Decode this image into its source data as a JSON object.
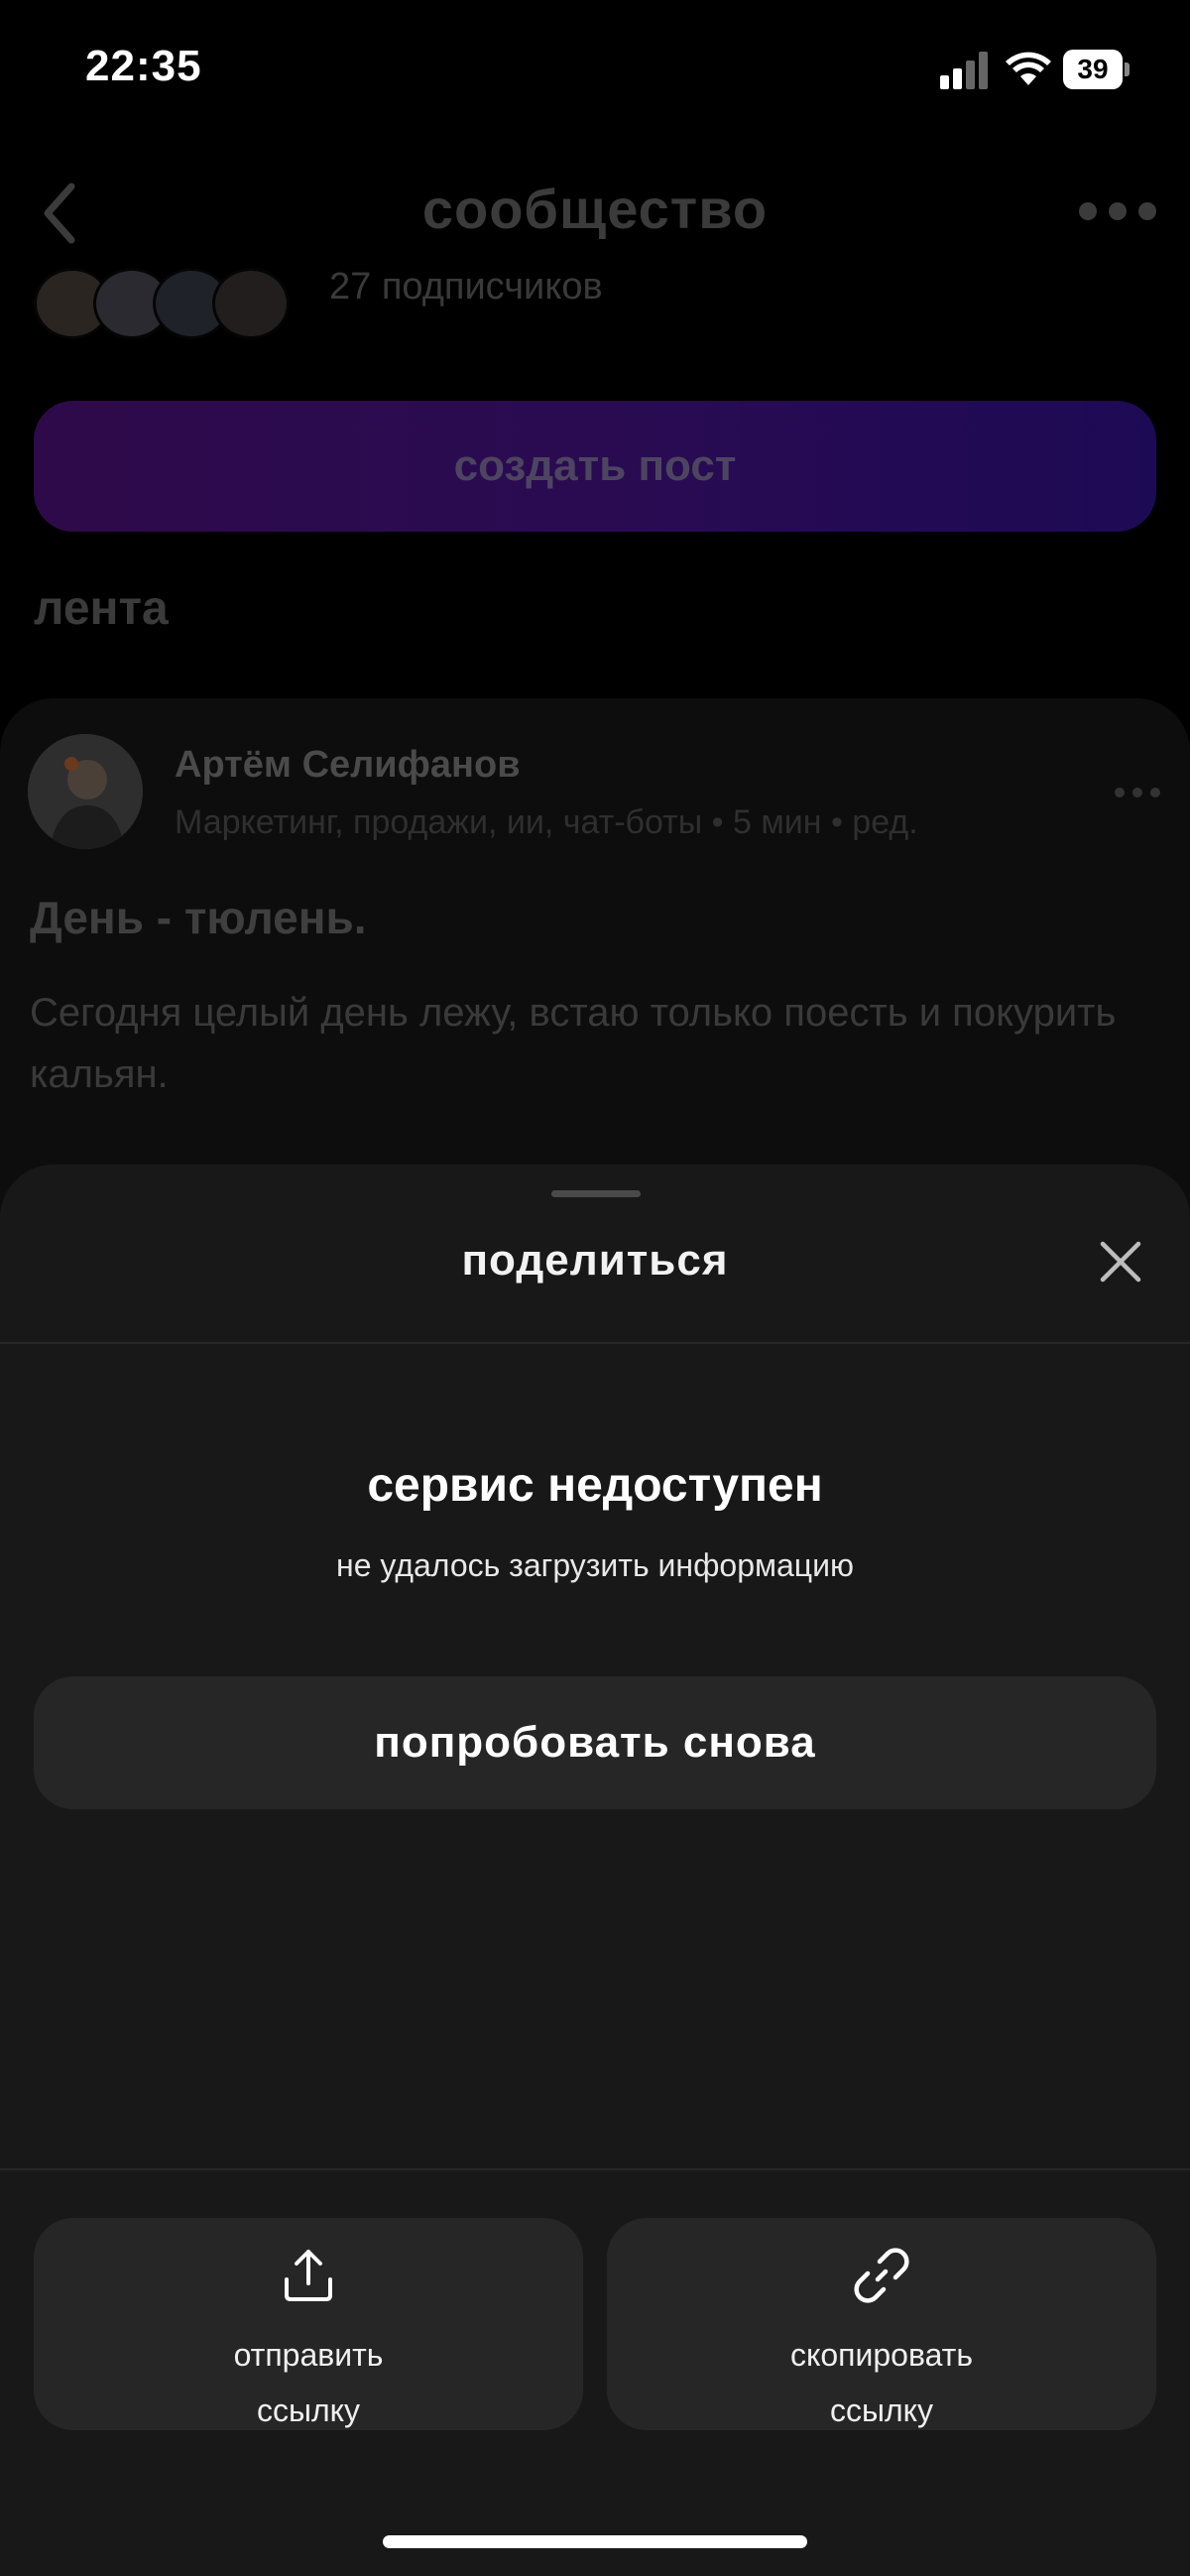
{
  "status_bar": {
    "time": "22:35",
    "battery": "39"
  },
  "header": {
    "title": "сообщество"
  },
  "community": {
    "subscribers": "27 подписчиков",
    "create_post_label": "создать пост",
    "feed_title": "лента"
  },
  "post": {
    "author": "Артём Селифанов",
    "meta": "Маркетинг, продажи, ии, чат-боты • 5 мин • ред.",
    "title": "День - тюлень.",
    "body": "Сегодня целый день лежу, встаю только поесть и покурить кальян."
  },
  "share_sheet": {
    "title": "поделиться",
    "error_title": "сервис недоступен",
    "error_subtitle": "не удалось загрузить информацию",
    "retry_label": "попробовать снова",
    "actions": [
      {
        "label": "отправить ссылку",
        "icon": "upload-icon"
      },
      {
        "label": "скопировать ссылку",
        "icon": "link-icon"
      }
    ]
  },
  "colors": {
    "sheet_bg": "#181818",
    "button_bg": "#262626",
    "create_post_gradient_start": "#2e0a4a",
    "create_post_gradient_end": "#1d0a55"
  }
}
